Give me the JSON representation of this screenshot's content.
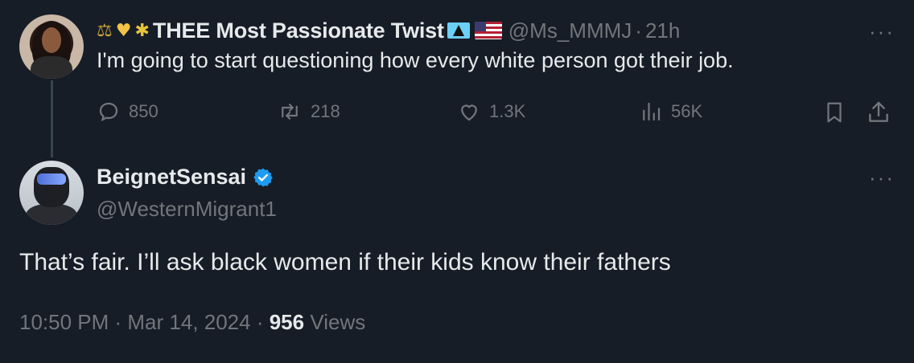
{
  "tweet1": {
    "display_name": "THEE Most Passionate Twist",
    "handle": "@Ms_MMMJ",
    "separator": "·",
    "time": "21h",
    "text": "I'm going to start questioning how every white person got their job.",
    "emoji_icons": [
      "balance-scale-icon",
      "yellow-heart-icon",
      "bee-icon"
    ],
    "flags": [
      "saint-lucia-flag-icon",
      "us-flag-icon"
    ],
    "more": "···",
    "actions": {
      "replies": "850",
      "retweets": "218",
      "likes": "1.3K",
      "views": "56K"
    }
  },
  "tweet2": {
    "display_name": "BeignetSensai",
    "handle": "@WesternMigrant1",
    "verified": true,
    "more": "···",
    "text": "That’s fair. I’ll ask black women if their kids know their fathers",
    "timestamp": "10:50 PM · Mar 14, 2024 ·",
    "views_count": "956",
    "views_label": "Views"
  },
  "colors": {
    "background": "#161d27",
    "primary_text": "#e7e9ea",
    "secondary_text": "#71767b",
    "verified_blue": "#1d9bf0",
    "thread_line": "#38444d"
  }
}
